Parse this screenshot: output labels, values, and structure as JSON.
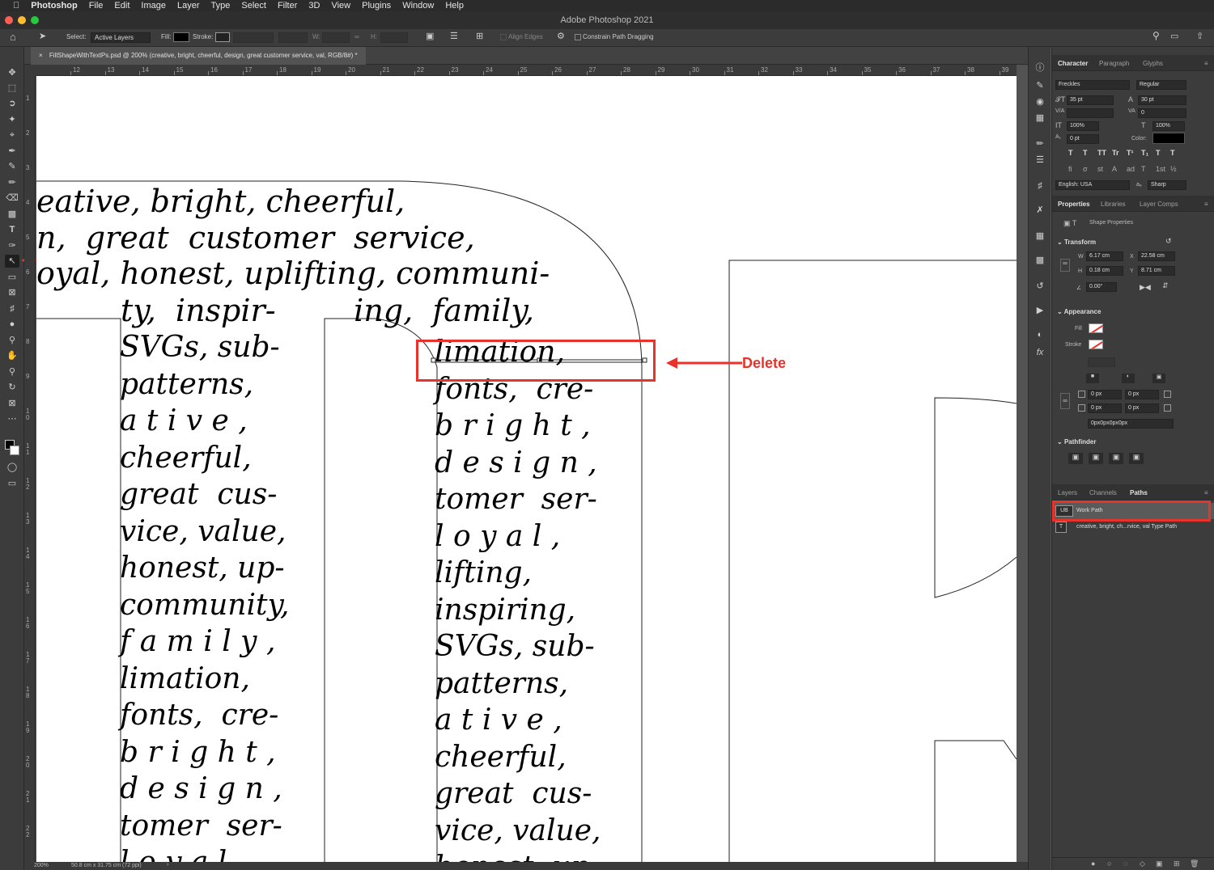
{
  "menubar": {
    "app": "Photoshop",
    "items": [
      "File",
      "Edit",
      "Image",
      "Layer",
      "Type",
      "Select",
      "Filter",
      "3D",
      "View",
      "Plugins",
      "Window",
      "Help"
    ]
  },
  "window": {
    "title": "Adobe Photoshop 2021"
  },
  "options": {
    "select_label": "Select:",
    "select_value": "Active Layers",
    "fill_label": "Fill:",
    "stroke_label": "Stroke:",
    "w_label": "W:",
    "h_label": "H:",
    "align_edges": "Align Edges",
    "constrain": "Constrain Path Dragging"
  },
  "document": {
    "tab": "FillShapeWithTextPs.psd @ 200% (creative, bright, cheerful, design, great customer service, val, RGB/8#) *"
  },
  "ruler_h": [
    "12",
    "13",
    "14",
    "15",
    "16",
    "17",
    "18",
    "19",
    "20",
    "21",
    "22",
    "23",
    "24",
    "25",
    "26",
    "27",
    "28",
    "29",
    "30",
    "31",
    "32",
    "33",
    "34",
    "35",
    "36",
    "37",
    "38",
    "39"
  ],
  "ruler_v": [
    "1",
    "2",
    "3",
    "4",
    "5",
    "6",
    "7",
    "8",
    "9",
    "1 0",
    "1 1",
    "1 2",
    "1 3",
    "1 4",
    "1 5",
    "1 6",
    "1 7",
    "1 8",
    "1 9",
    "2 0",
    "2 1",
    "2 2"
  ],
  "canvas": {
    "top_lines": [
      "eative, bright, cheerful,",
      "n,  great  customer  service,",
      "oyal, honest, uplifting, communi-",
      "ty,  inspir-        ing,  family,"
    ],
    "col_left": [
      "SVGs, sub-",
      "patterns,",
      "a t i v e ,",
      "cheerful,",
      "great  cus-",
      "vice, value,",
      "honest, up-",
      "community,",
      "f a m i l y ,",
      "limation,",
      "fonts,  cre-",
      "b r i g h t ,",
      "d e s i g n ,",
      "tomer  ser-",
      "l o y a l ,"
    ],
    "col_right": [
      "limation,",
      "fonts,  cre-",
      "b r i g h t ,",
      "d e s i g n ,",
      "tomer  ser-",
      "l o y a l ,",
      "lifting,",
      "inspiring,",
      "SVGs, sub-",
      "patterns,",
      "a t i v e ,",
      "cheerful,",
      "great  cus-",
      "vice, value,",
      "honest, up-"
    ],
    "annotation": "Delete"
  },
  "status": {
    "zoom": "200%",
    "size": "50.8 cm x 31.75 cm (72 ppi)"
  },
  "character": {
    "tabs": [
      "Character",
      "Paragraph",
      "Glyphs"
    ],
    "font": "Freckles",
    "style": "Regular",
    "size": "35 pt",
    "leading": "30 pt",
    "kerning": "",
    "tracking": "0",
    "vscale": "100%",
    "hscale": "100%",
    "baseline": "0 pt",
    "color_label": "Color:",
    "language": "English: USA",
    "aa_label": "aₐ",
    "antialias": "Sharp",
    "type_buttons": [
      "T",
      "T",
      "TT",
      "Tr",
      "T¹",
      "T₁",
      "T",
      "T"
    ],
    "ot_buttons": [
      "fi",
      "σ",
      "st",
      "A",
      "ad",
      "T",
      "1st",
      "½"
    ]
  },
  "properties": {
    "tabs": [
      "Properties",
      "Libraries",
      "Layer Comps"
    ],
    "kind": "Shape Properties",
    "transform_label": "Transform",
    "w_label": "W",
    "w": "6.17 cm",
    "x_label": "X",
    "x": "22.58 cm",
    "h_label": "H",
    "h": "0.18 cm",
    "y_label": "Y",
    "y": "8.71 cm",
    "angle": "0.00°",
    "appearance_label": "Appearance",
    "fill_label": "Fill",
    "stroke_label": "Stroke",
    "radius": [
      "0 px",
      "0 px",
      "0 px",
      "0 px"
    ],
    "radius_all": "0px0px0px0px",
    "pathfinder_label": "Pathfinder"
  },
  "paths_panel": {
    "tabs": [
      "Layers",
      "Channels",
      "Paths"
    ],
    "rows": [
      "Work Path",
      "creative, bright, ch...rvice, val Type Path"
    ]
  },
  "colors": {
    "highlight": "#e8322a",
    "panel": "#3c3c3c"
  }
}
